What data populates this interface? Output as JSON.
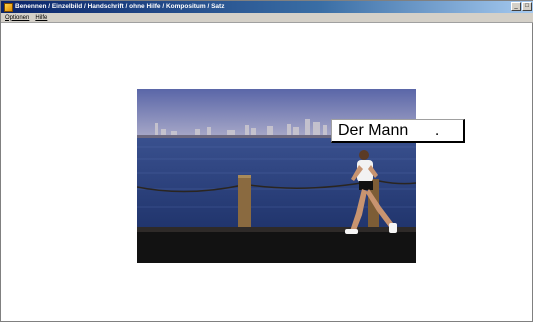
{
  "window": {
    "title": "Benennen / Einzelbild / Handschrift / ohne Hilfe / Kompositum / Satz",
    "icon": "app-icon",
    "controls": [
      "minimize-icon",
      "maximize-icon"
    ]
  },
  "menu": {
    "items": [
      {
        "label": "Optionen"
      },
      {
        "label": "Hilfe"
      }
    ]
  },
  "main": {
    "image_description": "",
    "caption_text": "Der Mann      ."
  },
  "colors": {
    "titlebar_start": "#0a246a",
    "titlebar_end": "#a6caf0",
    "menubar_bg": "#d4d0c8"
  }
}
